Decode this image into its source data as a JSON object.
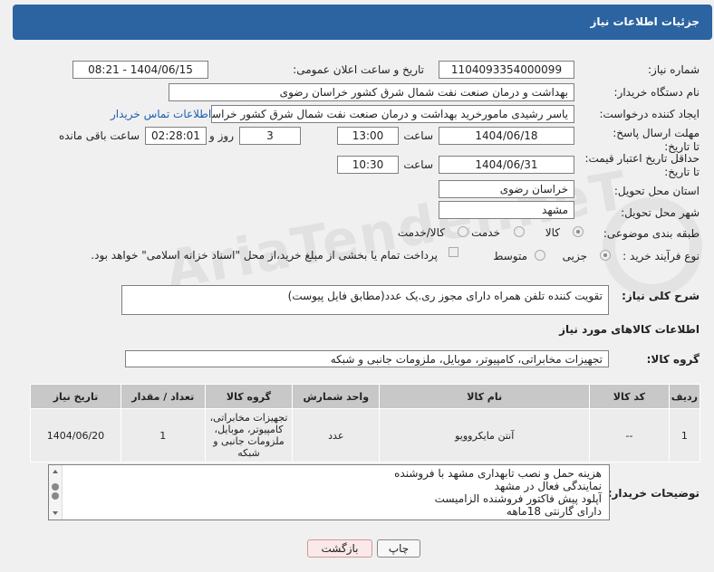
{
  "header": {
    "title": "جزئیات اطلاعات نیاز"
  },
  "fields": {
    "need_number_label": "شماره نیاز:",
    "need_number": "1104093354000099",
    "announce_label": "تاریخ و ساعت اعلان عمومی:",
    "announce_value": "1404/06/15 - 08:21",
    "buyer_org_label": "نام دستگاه خریدار:",
    "buyer_org": "بهداشت و درمان صنعت نفت شمال شرق کشور   خراسان رضوی",
    "creator_label": "ایجاد کننده درخواست:",
    "creator": "یاسر رشیدی مامورخرید بهداشت و درمان صنعت نفت شمال شرق کشور   خراسان رضوی",
    "buyer_contact_link": "اطلاعات تماس خریدار",
    "deadline_label": "مهلت ارسال پاسخ: تا تاریخ:",
    "deadline_date": "1404/06/18",
    "time_label": "ساعت",
    "deadline_time": "13:00",
    "days_value": "3",
    "days_label": "روز و",
    "remaining_time": "02:28:01",
    "remaining_label": "ساعت باقی مانده",
    "min_validity_label": "حداقل تاریخ اعتبار قیمت: تا تاریخ:",
    "validity_date": "1404/06/31",
    "validity_time": "10:30",
    "province_label": "استان محل تحویل:",
    "province": "خراسان رضوی",
    "city_label": "شهر محل تحویل:",
    "city": "مشهد",
    "category_label": "طبقه بندی موضوعی:",
    "category_options": [
      "کالا",
      "خدمت",
      "کالا/خدمت"
    ],
    "category_selected": "کالا",
    "process_label": "نوع فرآیند خرید :",
    "process_options": [
      "جزیی",
      "متوسط"
    ],
    "process_selected": "جزیی",
    "payment_note": "پرداخت تمام یا بخشی از مبلغ خرید،از محل \"اسناد خزانه اسلامی\" خواهد بود."
  },
  "description": {
    "label": "شرح کلی نیاز:",
    "value": "تقویت کننده تلفن همراه دارای مجوز ری.یک عدد(مطابق فایل پیوست)"
  },
  "goods_section": {
    "title": "اطلاعات کالاهای مورد نیاز",
    "group_label": "گروه کالا:",
    "group_value": "تجهیزات مخابراتی، کامپیوتر، موبایل، ملزومات جانبی و شبکه"
  },
  "table": {
    "headers": [
      "ردیف",
      "کد کالا",
      "نام کالا",
      "واحد شمارش",
      "گروه کالا",
      "تعداد / مقدار",
      "تاریخ نیاز"
    ],
    "rows": [
      [
        "1",
        "--",
        "آنتن مایکروویو",
        "عدد",
        "تجهیزات مخابراتی، کامپیوتر، موبایل، ملزومات جانبی و شبکه",
        "1",
        "1404/06/20"
      ]
    ]
  },
  "buyer_notes": {
    "label": "توضیحات خریدار:",
    "lines": [
      "هزینه حمل و نصب تابهداری مشهد با فروشنده",
      "نمایندگی فعال در مشهد",
      "آپلود پیش فاکتور فروشنده الزامیست",
      "دارای گارنتی 18ماهه"
    ]
  },
  "buttons": {
    "print": "چاپ",
    "back": "بازگشت"
  },
  "watermark": "AriaTender.neT"
}
